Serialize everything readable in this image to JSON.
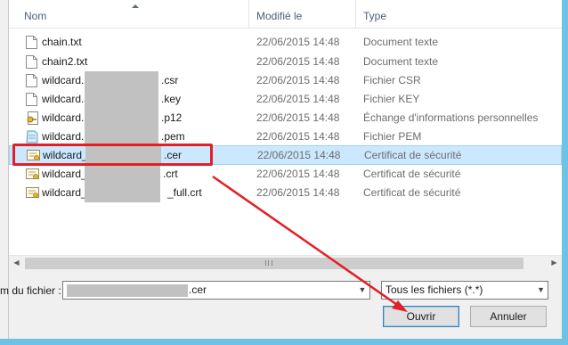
{
  "list": {
    "columns": {
      "name": "Nom",
      "date": "Modifié le",
      "type": "Type"
    },
    "rows": [
      {
        "name": "chain.txt",
        "date": "22/06/2015 14:48",
        "type": "Document texte",
        "icon": "text-file-icon",
        "redacted": false,
        "selected": false
      },
      {
        "name": "chain2.txt",
        "date": "22/06/2015 14:48",
        "type": "Document texte",
        "icon": "text-file-icon",
        "redacted": false,
        "selected": false
      },
      {
        "name_prefix": "wildcard.",
        "name_suffix": ".csr",
        "date": "22/06/2015 14:48",
        "type": "Fichier CSR",
        "icon": "text-file-icon",
        "redacted": true,
        "selected": false
      },
      {
        "name_prefix": "wildcard.",
        "name_suffix": ".key",
        "date": "22/06/2015 14:48",
        "type": "Fichier KEY",
        "icon": "text-file-icon",
        "redacted": true,
        "selected": false
      },
      {
        "name_prefix": "wildcard.",
        "name_suffix": ".p12",
        "date": "22/06/2015 14:48",
        "type": "Échange d'informations personnelles",
        "icon": "key-certificate-icon",
        "redacted": true,
        "selected": false
      },
      {
        "name_prefix": "wildcard.",
        "name_suffix": ".pem",
        "date": "22/06/2015 14:48",
        "type": "Fichier PEM",
        "icon": "pem-file-icon",
        "redacted": true,
        "selected": false
      },
      {
        "name_prefix": "wildcard_",
        "name_suffix": ".cer",
        "date": "22/06/2015 14:48",
        "type": "Certificat de sécurité",
        "icon": "certificate-icon",
        "redacted": true,
        "selected": true
      },
      {
        "name_prefix": "wildcard_",
        "name_suffix": ".crt",
        "date": "22/06/2015 14:48",
        "type": "Certificat de sécurité",
        "icon": "certificate-icon",
        "redacted": true,
        "selected": false
      },
      {
        "name_prefix": "wildcard_",
        "name_suffix": "_full.crt",
        "date": "22/06/2015 14:48",
        "type": "Certificat de sécurité",
        "icon": "certificate-icon",
        "redacted": true,
        "selected": false
      }
    ]
  },
  "filename": {
    "label": "m du fichier :",
    "value_suffix": ".cer"
  },
  "filter": {
    "selected": "Tous les fichiers (*.*)"
  },
  "buttons": {
    "open": "Ouvrir",
    "cancel": "Annuler"
  },
  "colors": {
    "annotation": "#e21f26",
    "selection": "#cce8ff",
    "accent_frame": "#6ec3e4"
  }
}
